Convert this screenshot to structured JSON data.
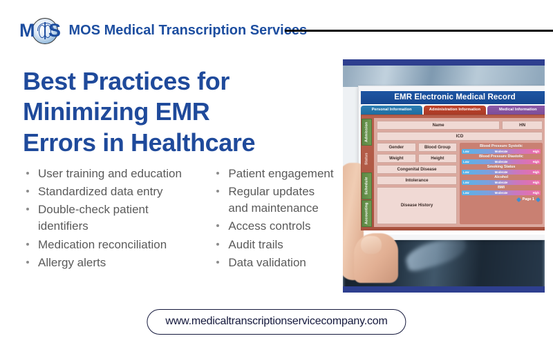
{
  "brand": {
    "logo_m": "M",
    "logo_s": "S",
    "name": "MOS Medical Transcription Services",
    "blue": "#1d4ea0"
  },
  "title": {
    "line1": "Best Practices for",
    "line2": "Minimizing EMR",
    "line3": "Errors in Healthcare",
    "color": "#1f4a9b"
  },
  "bullets": {
    "left": [
      "User training and education",
      "Standardized data entry",
      "Double-check patient identifiers",
      "Medication reconciliation",
      "Allergy alerts"
    ],
    "right": [
      "Patient engagement",
      "Regular updates and maintenance",
      "Access controls",
      "Audit trails",
      "Data validation"
    ]
  },
  "url": "www.medicaltranscriptionservicecompany.com",
  "emr": {
    "header": "EMR Electronic Medical Record",
    "tabs": [
      "Personal Information",
      "Administration Information",
      "Medical Information"
    ],
    "side_tabs": [
      "Admission",
      "Status",
      "Schedule",
      "Accounting"
    ],
    "fields": {
      "name": "Name",
      "hn": "HN",
      "icd": "ICD",
      "gender": "Gender",
      "blood_group": "Blood Group",
      "weight": "Weight",
      "height": "Height",
      "congenital": "Congenital Disease",
      "intolerance": "Intolerance",
      "history": "Disease History"
    },
    "sliders": [
      "Blood Pressure Systolic",
      "Blood Pressure Diastolic",
      "Smoking Status",
      "Alcohol",
      "BMI"
    ],
    "scale": {
      "low": "Low",
      "moderate": "Moderate",
      "high": "High"
    },
    "page": "Page 1"
  }
}
